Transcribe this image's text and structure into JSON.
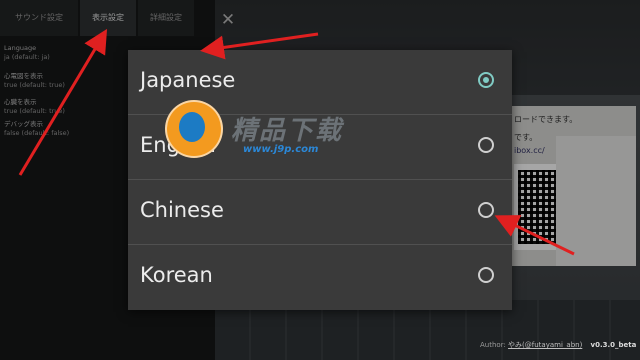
{
  "tabs": [
    {
      "label": "サウンド設定"
    },
    {
      "label": "表示設定"
    },
    {
      "label": "詳細設定"
    }
  ],
  "close_icon": "✕",
  "settings": [
    {
      "name": "Language",
      "value": "ja (default: ja)"
    },
    {
      "name": "心電図を表示",
      "value": "true (default: true)"
    },
    {
      "name": "心臓を表示",
      "value": "true (default: true)"
    },
    {
      "name": "デバッグ表示",
      "value": "false (default: false)"
    }
  ],
  "dialog": {
    "options": [
      {
        "label": "Japanese",
        "selected": true
      },
      {
        "label": "English",
        "selected": false
      },
      {
        "label": "Chinese",
        "selected": false
      },
      {
        "label": "Korean",
        "selected": false
      }
    ]
  },
  "background_notice": {
    "line1": "ロードできます。",
    "line2": "です。",
    "line3": "ibox.cc/"
  },
  "watermark": {
    "brand": "精品下载",
    "site": "www.j9p.com"
  },
  "footer": {
    "author_prefix": "Author:",
    "author_handle": "やみ(@futayami_abn)",
    "version": "v0.3.0_beta"
  },
  "colors": {
    "accent": "#80cbc4",
    "annotation": "#e02020",
    "dialog_bg": "#3a3a3a"
  }
}
